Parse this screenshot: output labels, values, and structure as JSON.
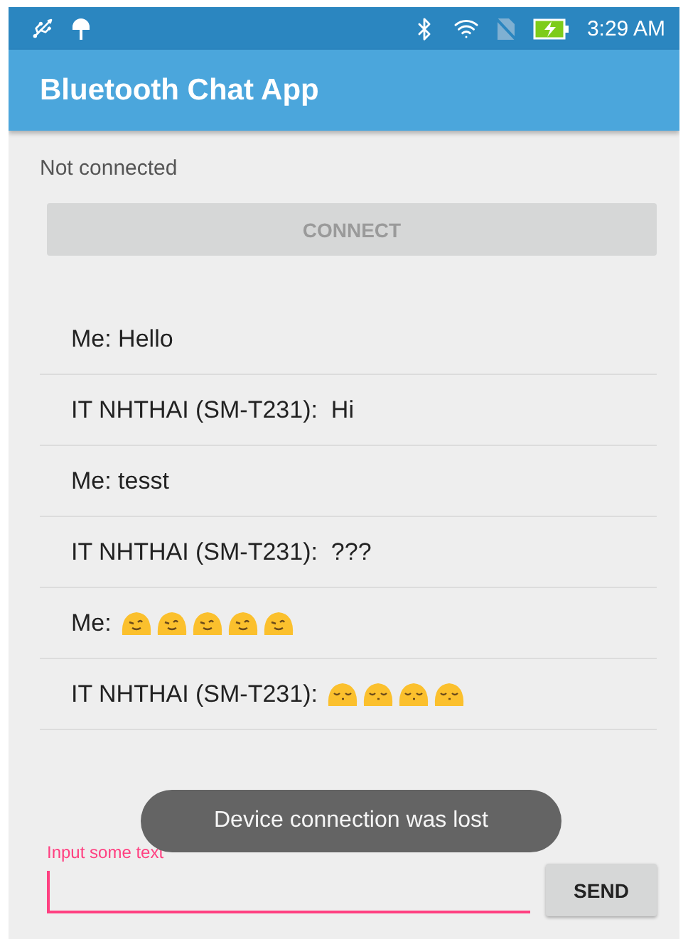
{
  "status_bar": {
    "time": "3:29 AM",
    "battery_charging": true
  },
  "app_bar": {
    "title": "Bluetooth Chat App"
  },
  "connection": {
    "status": "Not connected",
    "button": {
      "label": "CONNECT",
      "disabled": true
    }
  },
  "messages": [
    {
      "text": "Me: Hello"
    },
    {
      "text": "IT NHTHAI (SM-T231):  Hi"
    },
    {
      "text": "Me: tesst"
    },
    {
      "text": "IT NHTHAI (SM-T231):  ???"
    },
    {
      "text": "Me:",
      "emojis": [
        {
          "kind": "wink"
        },
        {
          "kind": "wink"
        },
        {
          "kind": "wink"
        },
        {
          "kind": "wink"
        },
        {
          "kind": "wink"
        }
      ]
    },
    {
      "text": "IT NHTHAI (SM-T231):",
      "emojis": [
        {
          "kind": "kiss"
        },
        {
          "kind": "kiss"
        },
        {
          "kind": "kiss"
        },
        {
          "kind": "kiss"
        }
      ]
    }
  ],
  "toast": "Device connection was lost",
  "composer": {
    "placeholder": "Input some text",
    "focused": true,
    "send_button": "SEND"
  }
}
